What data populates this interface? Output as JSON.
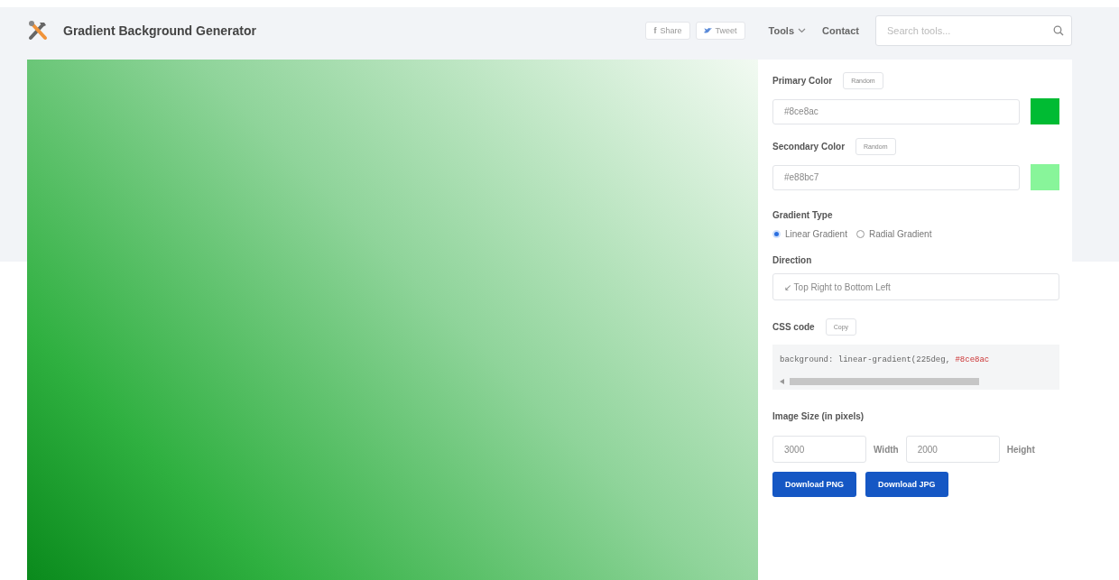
{
  "header": {
    "title": "Gradient Background Generator",
    "share_buttons": [
      {
        "glyph": "f",
        "label": "Share"
      },
      {
        "label": "Tweet"
      }
    ],
    "nav": [
      {
        "label": "Tools",
        "dropdown": true
      },
      {
        "label": "Contact",
        "dropdown": false
      }
    ],
    "search": {
      "placeholder": "Search tools..."
    }
  },
  "controls": {
    "primary": {
      "label": "Primary Color",
      "button": "Random",
      "value": "#8ce8ac",
      "color": "#00bb33"
    },
    "secondary": {
      "label": "Secondary Color",
      "button": "Random",
      "value": "#e88bc7",
      "color": "#88f59a"
    },
    "gradient_type": {
      "label": "Gradient Type",
      "options": [
        {
          "label": "Linear Gradient",
          "selected": true
        },
        {
          "label": "Radial Gradient",
          "selected": false
        }
      ]
    },
    "direction": {
      "label": "Direction",
      "value": "↙ Top Right to Bottom Left"
    },
    "css_code": {
      "label": "CSS code",
      "button": "Copy",
      "text": "background: linear-gradient(225deg,",
      "value": "#8ce8ac"
    },
    "image_size": {
      "label": "Image Size (in pixels)",
      "items": [
        {
          "kind": "input",
          "text": "3000"
        },
        {
          "kind": "text",
          "text": "Width"
        },
        {
          "kind": "input",
          "text": "2000"
        },
        {
          "kind": "text",
          "text": "Height"
        }
      ]
    },
    "downloads": [
      "Download PNG",
      "Download JPG"
    ]
  }
}
